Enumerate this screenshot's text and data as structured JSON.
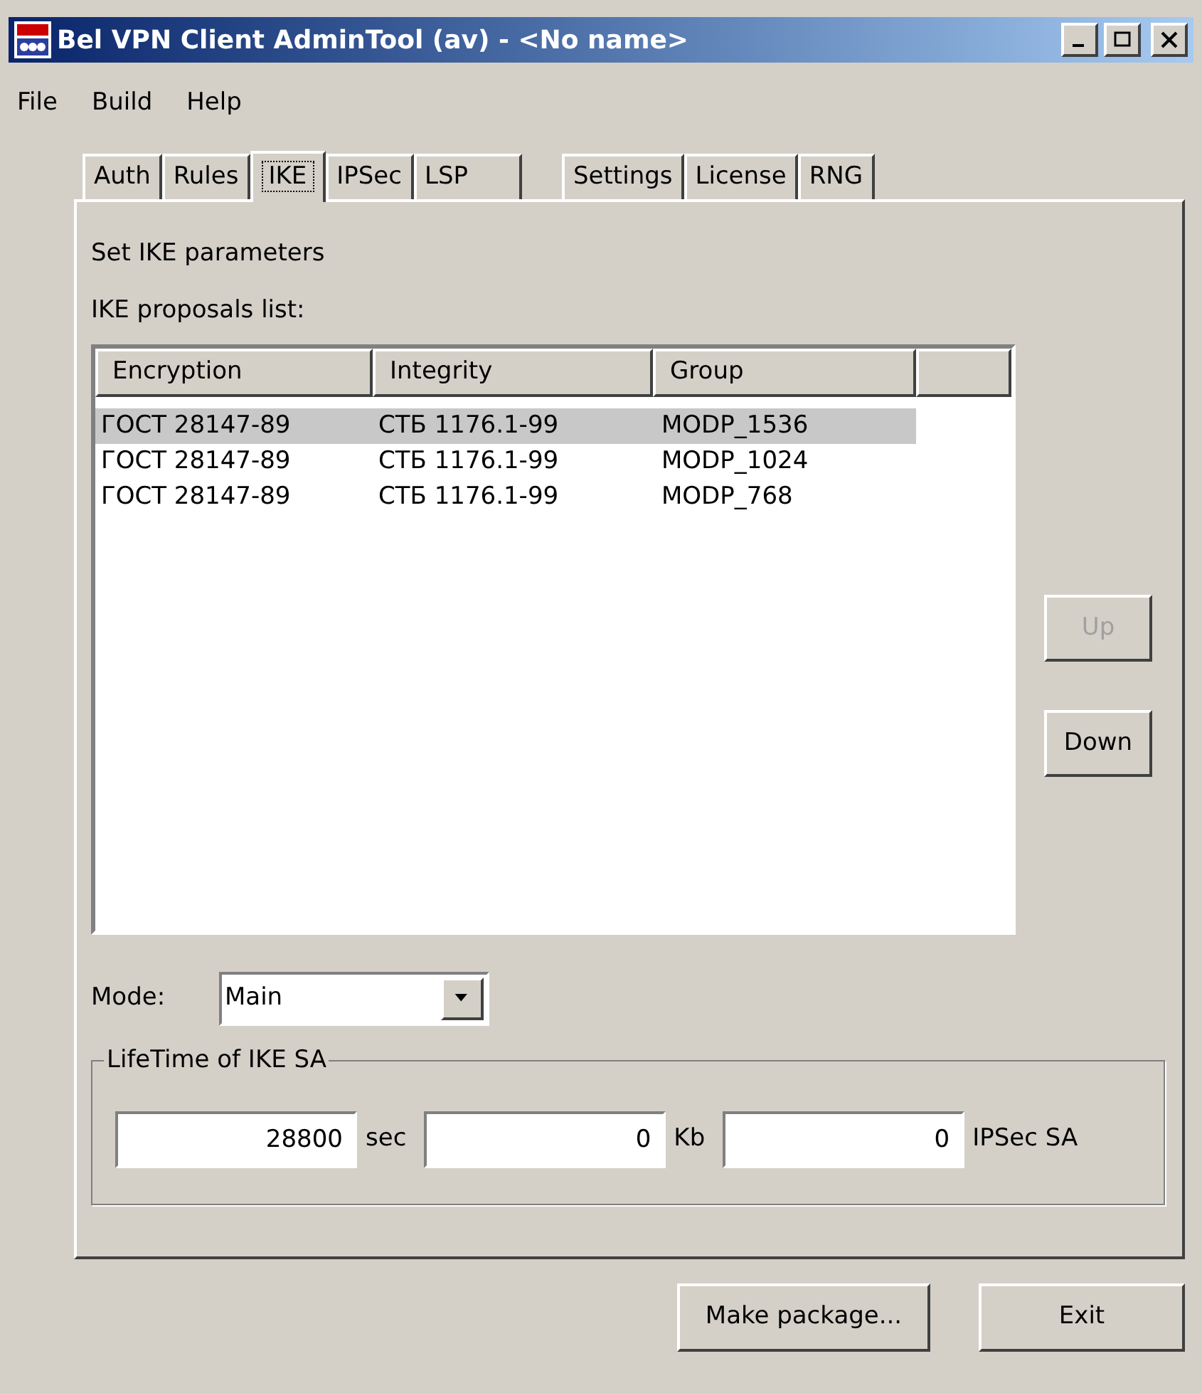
{
  "window": {
    "title": "Bel VPN Client AdminTool (av) - <No name>"
  },
  "menu": [
    "File",
    "Build",
    "Help"
  ],
  "tabs": [
    {
      "label": "Auth",
      "selected": false
    },
    {
      "label": "Rules",
      "selected": false
    },
    {
      "label": "IKE",
      "selected": true
    },
    {
      "label": "IPSec",
      "selected": false
    },
    {
      "label": "LSP",
      "selected": false
    },
    {
      "label": "Settings",
      "selected": false
    },
    {
      "label": "License",
      "selected": false
    },
    {
      "label": "RNG",
      "selected": false
    }
  ],
  "panel": {
    "heading": "Set IKE parameters",
    "list_label": "IKE proposals list:",
    "columns": [
      "Encryption",
      "Integrity",
      "Group"
    ],
    "rows": [
      {
        "cells": [
          "ГОСТ 28147-89",
          "СТБ 1176.1-99",
          "MODP_1536"
        ],
        "selected": true
      },
      {
        "cells": [
          "ГОСТ 28147-89",
          "СТБ 1176.1-99",
          "MODP_1024"
        ],
        "selected": false
      },
      {
        "cells": [
          "ГОСТ 28147-89",
          "СТБ 1176.1-99",
          "MODP_768"
        ],
        "selected": false
      }
    ],
    "side_buttons": [
      {
        "label": "Up",
        "disabled": true
      },
      {
        "label": "Down",
        "disabled": false
      }
    ],
    "mode": {
      "label": "Mode:",
      "value": "Main"
    },
    "lifetime": {
      "title": "LifeTime of IKE SA",
      "fields": [
        {
          "value": "28800",
          "unit": "sec"
        },
        {
          "value": "0",
          "unit": "Kb"
        },
        {
          "value": "0",
          "unit": "IPSec SA"
        }
      ]
    }
  },
  "buttons": [
    "Make package...",
    "Exit"
  ]
}
